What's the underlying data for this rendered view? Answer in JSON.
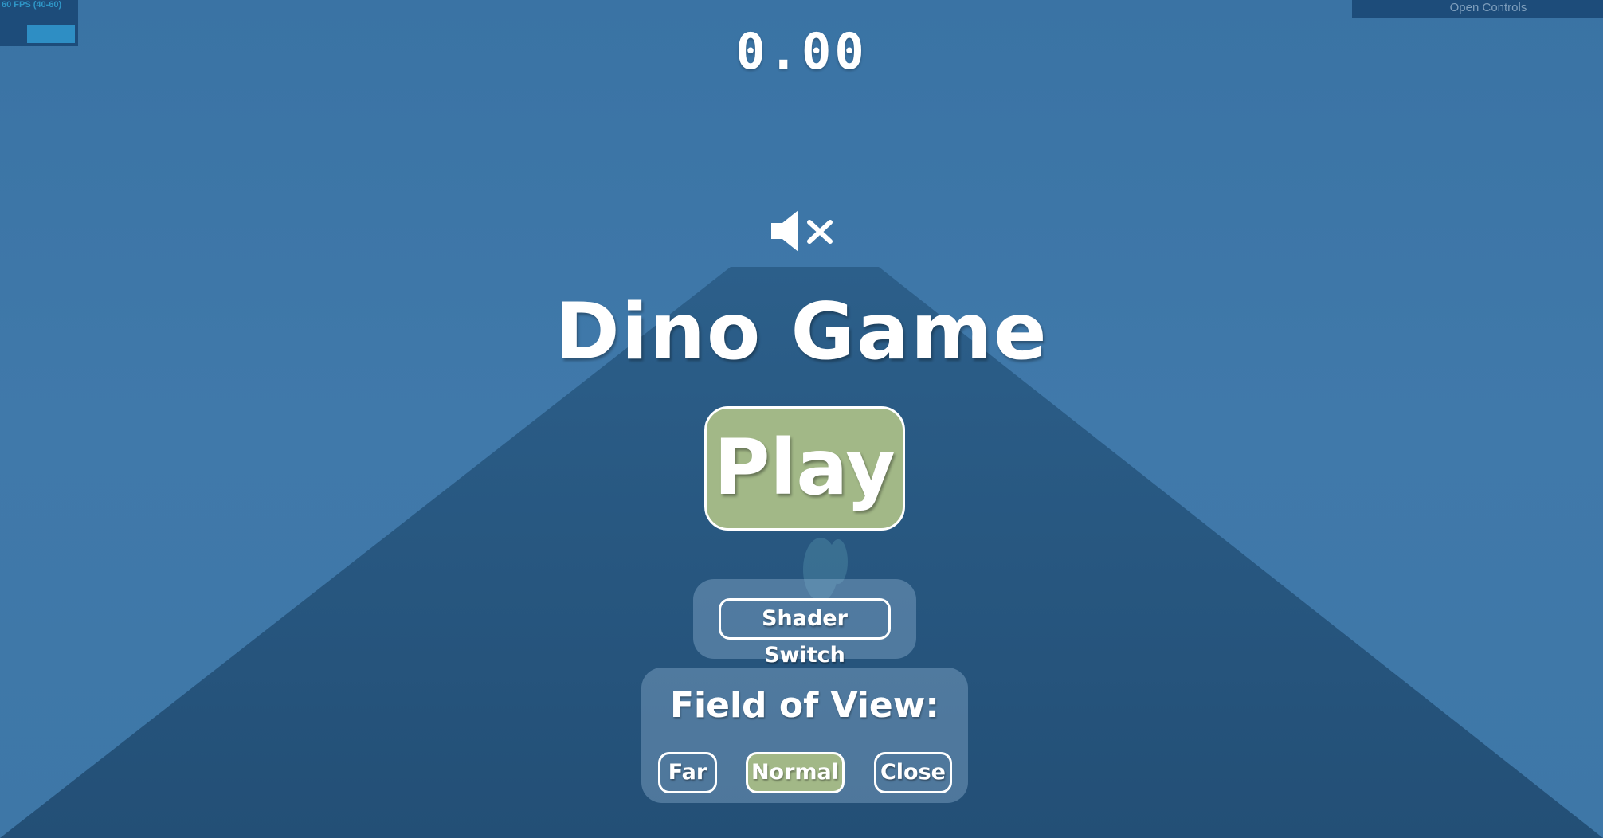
{
  "colors": {
    "sky": "#3f78a8",
    "ground": "#27577f",
    "accent": "#a2b887",
    "text": "#ffffff"
  },
  "debug": {
    "fps_text": "60 FPS (40-60)",
    "open_controls": "Open Controls"
  },
  "hud": {
    "score": "0.00",
    "mute_icon": "speaker-muted-icon",
    "muted": true
  },
  "menu": {
    "title": "Dino Game",
    "play_label": "Play",
    "shader_switch_label": "Shader Switch",
    "fov": {
      "label": "Field of View:",
      "options": [
        "Far",
        "Normal",
        "Close"
      ],
      "selected": "Normal"
    }
  }
}
